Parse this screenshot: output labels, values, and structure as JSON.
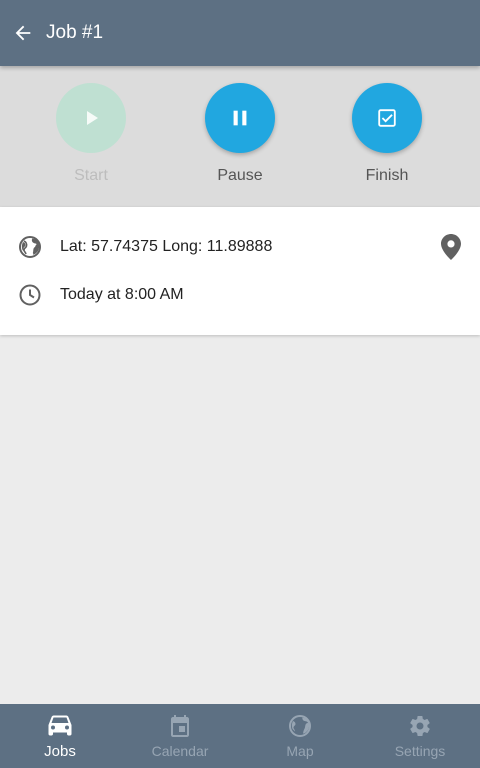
{
  "appbar": {
    "title": "Job #1",
    "back_icon": "arrow-left-icon"
  },
  "actions": {
    "start": {
      "label": "Start",
      "icon": "play-icon",
      "enabled": false
    },
    "pause": {
      "label": "Pause",
      "icon": "pause-icon",
      "enabled": true
    },
    "finish": {
      "label": "Finish",
      "icon": "checkbox-icon",
      "enabled": true
    }
  },
  "details": {
    "location": "Lat: 57.74375 Long: 11.89888",
    "location_icon": "globe-icon",
    "map_pin_icon": "map-pin-icon",
    "time": "Today at 8:00 AM",
    "time_icon": "clock-icon"
  },
  "nav": {
    "items": [
      {
        "label": "Jobs",
        "icon": "car-icon",
        "active": true
      },
      {
        "label": "Calendar",
        "icon": "calendar-icon",
        "active": false
      },
      {
        "label": "Map",
        "icon": "globe-icon",
        "active": false
      },
      {
        "label": "Settings",
        "icon": "gear-icon",
        "active": false
      }
    ]
  },
  "colors": {
    "appbar": "#5d7083",
    "accent": "#21a7e0",
    "disabled_action": "#bfe0d2",
    "nav_inactive": "#97a5b3"
  }
}
